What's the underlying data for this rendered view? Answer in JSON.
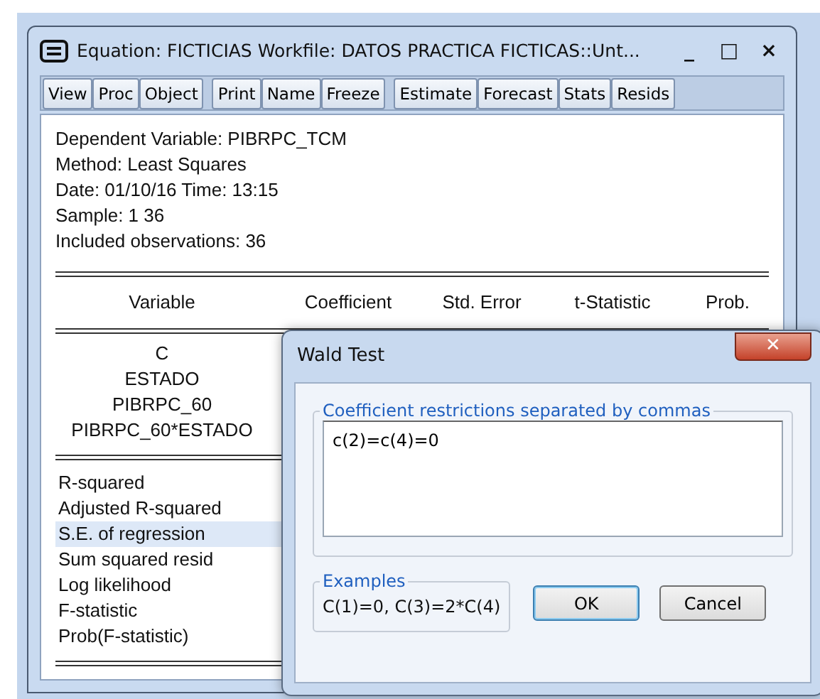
{
  "window": {
    "title": "Equation: FICTICIAS   Workfile: DATOS PRACTICA FICTICAS::Unt...",
    "controls": [
      "_",
      "□",
      "×"
    ]
  },
  "toolbar": [
    [
      "View",
      "Proc",
      "Object"
    ],
    [
      "Print",
      "Name",
      "Freeze"
    ],
    [
      "Estimate",
      "Forecast",
      "Stats",
      "Resids"
    ]
  ],
  "header_lines": [
    "Dependent Variable: PIBRPC_TCM",
    "Method: Least Squares",
    "Date: 01/10/16   Time: 13:15",
    "Sample: 1 36",
    "Included observations: 36"
  ],
  "table": {
    "columns": [
      "Variable",
      "Coefficient",
      "Std. Error",
      "t-Statistic",
      "Prob."
    ],
    "rows": [
      {
        "variable": "C"
      },
      {
        "variable": "ESTADO"
      },
      {
        "variable": "PIBRPC_60"
      },
      {
        "variable": "PIBRPC_60*ESTADO"
      }
    ]
  },
  "statistics": [
    {
      "label": "R-squared",
      "selected": false
    },
    {
      "label": "Adjusted R-squared",
      "selected": false
    },
    {
      "label": "S.E. of regression",
      "selected": true
    },
    {
      "label": "Sum squared resid",
      "selected": false
    },
    {
      "label": "Log likelihood",
      "selected": false
    },
    {
      "label": "F-statistic",
      "selected": false
    },
    {
      "label": "Prob(F-statistic)",
      "selected": false
    }
  ],
  "dialog": {
    "title": "Wald Test",
    "close": "✕",
    "restrictions_group": "Coefficient restrictions separated by commas",
    "restrictions_value": "c(2)=c(4)=0",
    "examples_group": "Examples",
    "examples_text": "C(1)=0,  C(3)=2*C(4)",
    "buttons": [
      {
        "label": "OK",
        "default": true
      },
      {
        "label": "Cancel",
        "default": false
      }
    ]
  }
}
